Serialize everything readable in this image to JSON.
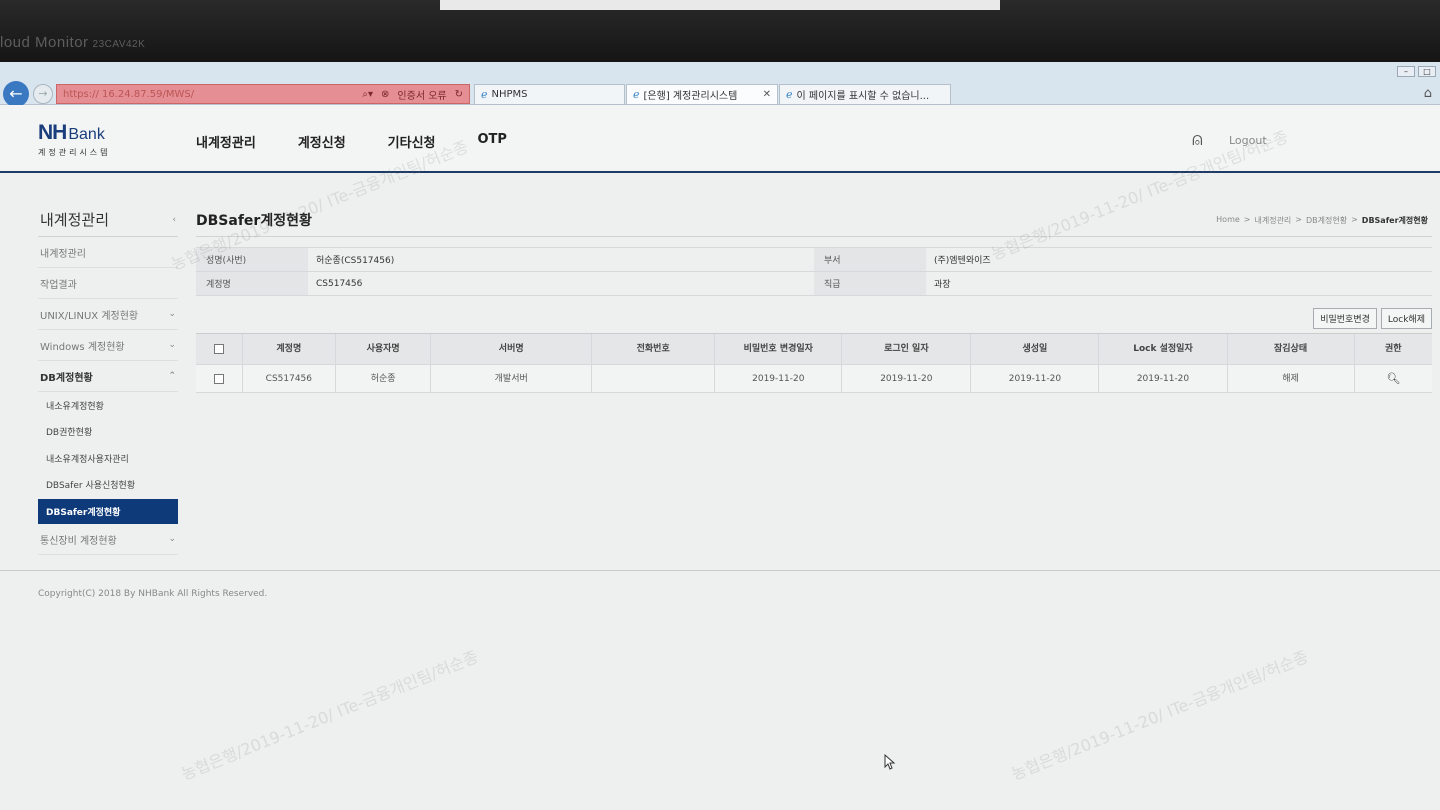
{
  "monitor": {
    "label": "loud Monitor",
    "model": "23CAV42K"
  },
  "browser": {
    "address": {
      "url_prefix": "https:// 16.24.87.59",
      "url_path": "/MWS/",
      "cert_error": "인증서 오류"
    },
    "tabs": [
      {
        "label": "NHPMS"
      },
      {
        "label": "[은행] 계정관리시스템"
      },
      {
        "label": "이 페이지를 표시할 수 없습니..."
      }
    ]
  },
  "site": {
    "logo_nh": "NH",
    "logo_bank": "Bank",
    "logo_sub": "계정관리시스템",
    "gnb": [
      "내계정관리",
      "계정신청",
      "기타신청",
      "OTP"
    ],
    "logout": "Logout"
  },
  "lnb": {
    "title": "내계정관리",
    "items": [
      "내계정관리",
      "작업결과",
      "UNIX/LINUX 계정현황",
      "Windows 계정현황",
      "DB계정현황"
    ],
    "sub_items": [
      "내소유계정현황",
      "DB권한현황",
      "내소유계정사용자관리",
      "DBSafer 사용신청현황",
      "DBSafer계정현황"
    ],
    "last_item": "통신장비 계정현황"
  },
  "page": {
    "title": "DBSafer계정현황",
    "breadcrumb": [
      "Home",
      "내계정관리",
      "DB계정현황",
      "DBSafer계정현황"
    ]
  },
  "info": {
    "name_label": "성명(사번)",
    "name_value": "허순종(CS517456)",
    "dept_label": "부서",
    "dept_value": "(주)엠텐와이즈",
    "account_label": "계정명",
    "account_value": "CS517456",
    "rank_label": "직급",
    "rank_value": "과장"
  },
  "buttons": {
    "pw_change": "비밀번호변경",
    "unlock": "Lock해제"
  },
  "grid": {
    "headers": [
      "계정명",
      "사용자명",
      "서버명",
      "전화번호",
      "비밀번호 변경일자",
      "로그인 일자",
      "생성일",
      "Lock 설정일자",
      "잠김상태",
      "권한"
    ],
    "rows": [
      {
        "account": "CS517456",
        "user": "허순종",
        "server": "개발서버",
        "phone": "",
        "pw_changed": "2019-11-20",
        "login": "2019-11-20",
        "created": "2019-11-20",
        "lock_date": "2019-11-20",
        "lock_state": "해제"
      }
    ]
  },
  "footer": {
    "copyright": "Copyright(C) 2018 By NHBank All Rights Reserved."
  },
  "watermark": {
    "text": "농협은행/2019-11-20/ ITe-금융개인팀/허순종"
  }
}
